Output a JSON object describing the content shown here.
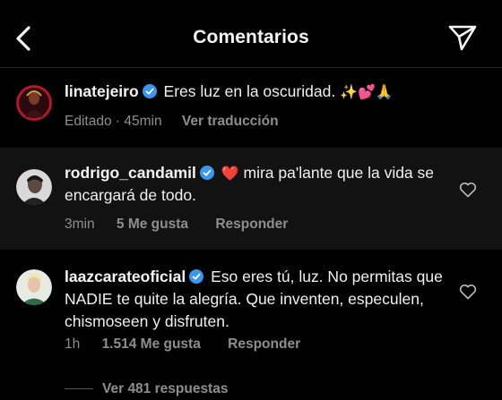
{
  "header": {
    "title": "Comentarios"
  },
  "caption": {
    "username": "linatejeiro",
    "text": "Eres luz en la oscuridad.",
    "emojis": "✨💕🙏",
    "edited": "Editado · 45min",
    "translate": "Ver traducción"
  },
  "comments": [
    {
      "username": "rodrigo_candamil",
      "heart_emoji": "❤️",
      "text": "mira pa'lante que la vida se encargará de todo.",
      "time": "3min",
      "likes": "5 Me gusta",
      "reply": "Responder"
    },
    {
      "username": "laazcarateoficial",
      "text": "Eso eres tú, luz. No permitas que NADIE te quite la alegría. Que inventen, especulen, chismoseen y disfruten.",
      "time": "1h",
      "likes": "1.514 Me gusta",
      "reply": "Responder",
      "view_replies": "Ver 481 respuestas"
    }
  ],
  "colors": {
    "background": "#000000",
    "highlight_row": "#121212",
    "secondary_text": "#8e8e8e",
    "verified_blue": "#3897f0",
    "heart_red": "#ed4956"
  },
  "icons": {
    "back": "chevron-left-icon",
    "send": "paper-plane-icon",
    "verified": "verified-badge-icon",
    "like": "heart-outline-icon"
  }
}
